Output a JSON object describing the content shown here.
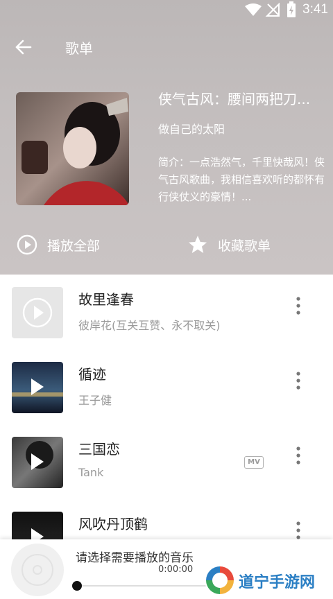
{
  "status_bar": {
    "time": "3:41"
  },
  "nav": {
    "title": "歌单"
  },
  "playlist": {
    "title": "侠气古风：腰间两把刀...",
    "author": "做自己的太阳",
    "intro": "简介：一点浩然气，千里快哉风！侠气古风歌曲，我相信喜欢听的都怀有行侠仗义的豪情！..."
  },
  "actions": {
    "play_all": "播放全部",
    "collect": "收藏歌单"
  },
  "songs": [
    {
      "name": "故里逢春",
      "artist": "彼岸花(互关互赞、永不取关)"
    },
    {
      "name": "循迹",
      "artist": "王子健"
    },
    {
      "name": "三国恋",
      "artist": "Tank",
      "badge": "MV"
    },
    {
      "name": "风吹丹顶鹤",
      "artist": ""
    }
  ],
  "player": {
    "title": "请选择需要播放的音乐",
    "time": "0:00:00/0"
  },
  "watermark": {
    "text": "道宁手游网"
  },
  "colors": {
    "header_bg": "#c1bcbc",
    "accent_text": "#ffffff",
    "watermark": "#2b7fc4"
  }
}
